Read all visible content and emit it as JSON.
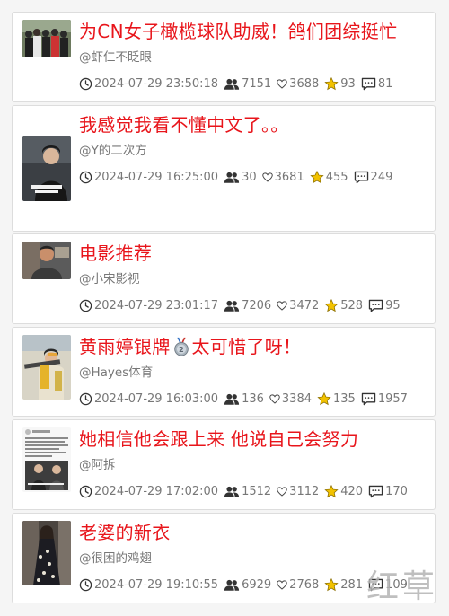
{
  "feed": {
    "posts": [
      {
        "title": "为CN女子橄榄球队助威！鸽们团综挺忙",
        "author": "@虾仁不眨眼",
        "time": "2024-07-29 23:50:18",
        "views": "7151",
        "likes": "3688",
        "favorites": "93",
        "comments": "81",
        "thumb_scene": "group-photo"
      },
      {
        "title": "我感觉我看不懂中文了。。",
        "author": "@Y的二次方",
        "time": "2024-07-29 16:25:00",
        "views": "30",
        "likes": "3681",
        "favorites": "455",
        "comments": "249",
        "thumb_scene": "person-with-caption"
      },
      {
        "title": "电影推荐",
        "author": "@小宋影视",
        "time": "2024-07-29 23:01:17",
        "views": "7206",
        "likes": "3472",
        "favorites": "528",
        "comments": "95",
        "thumb_scene": "movie-still"
      },
      {
        "title_before": "黄雨婷银牌",
        "title_emoji": "silver-medal-icon",
        "title_after": "太可惜了呀！",
        "author": "@Hayes体育",
        "time": "2024-07-29 16:03:00",
        "views": "136",
        "likes": "3384",
        "favorites": "135",
        "comments": "1957",
        "thumb_scene": "shooter"
      },
      {
        "title": "她相信他会跟上来 他说自己会努力",
        "author": "@阿拆",
        "time": "2024-07-29 17:02:00",
        "views": "1512",
        "likes": "3112",
        "favorites": "420",
        "comments": "170",
        "thumb_scene": "text-screenshot"
      },
      {
        "title": "老婆的新衣",
        "author": "@很困的鸡翅",
        "time": "2024-07-29 19:10:55",
        "views": "6929",
        "likes": "2768",
        "favorites": "281",
        "comments": "109",
        "thumb_scene": "dress-photo"
      }
    ]
  },
  "watermark": "红草",
  "colors": {
    "title": "#e8151b",
    "meta_text": "#777777",
    "star": "#f2c200",
    "card_border": "#dddddd",
    "background": "#f5f5f5"
  },
  "icons": {
    "time": "clock-icon",
    "views": "users-icon",
    "likes": "heart-icon",
    "favorites": "star-icon",
    "comments": "comment-icon"
  }
}
